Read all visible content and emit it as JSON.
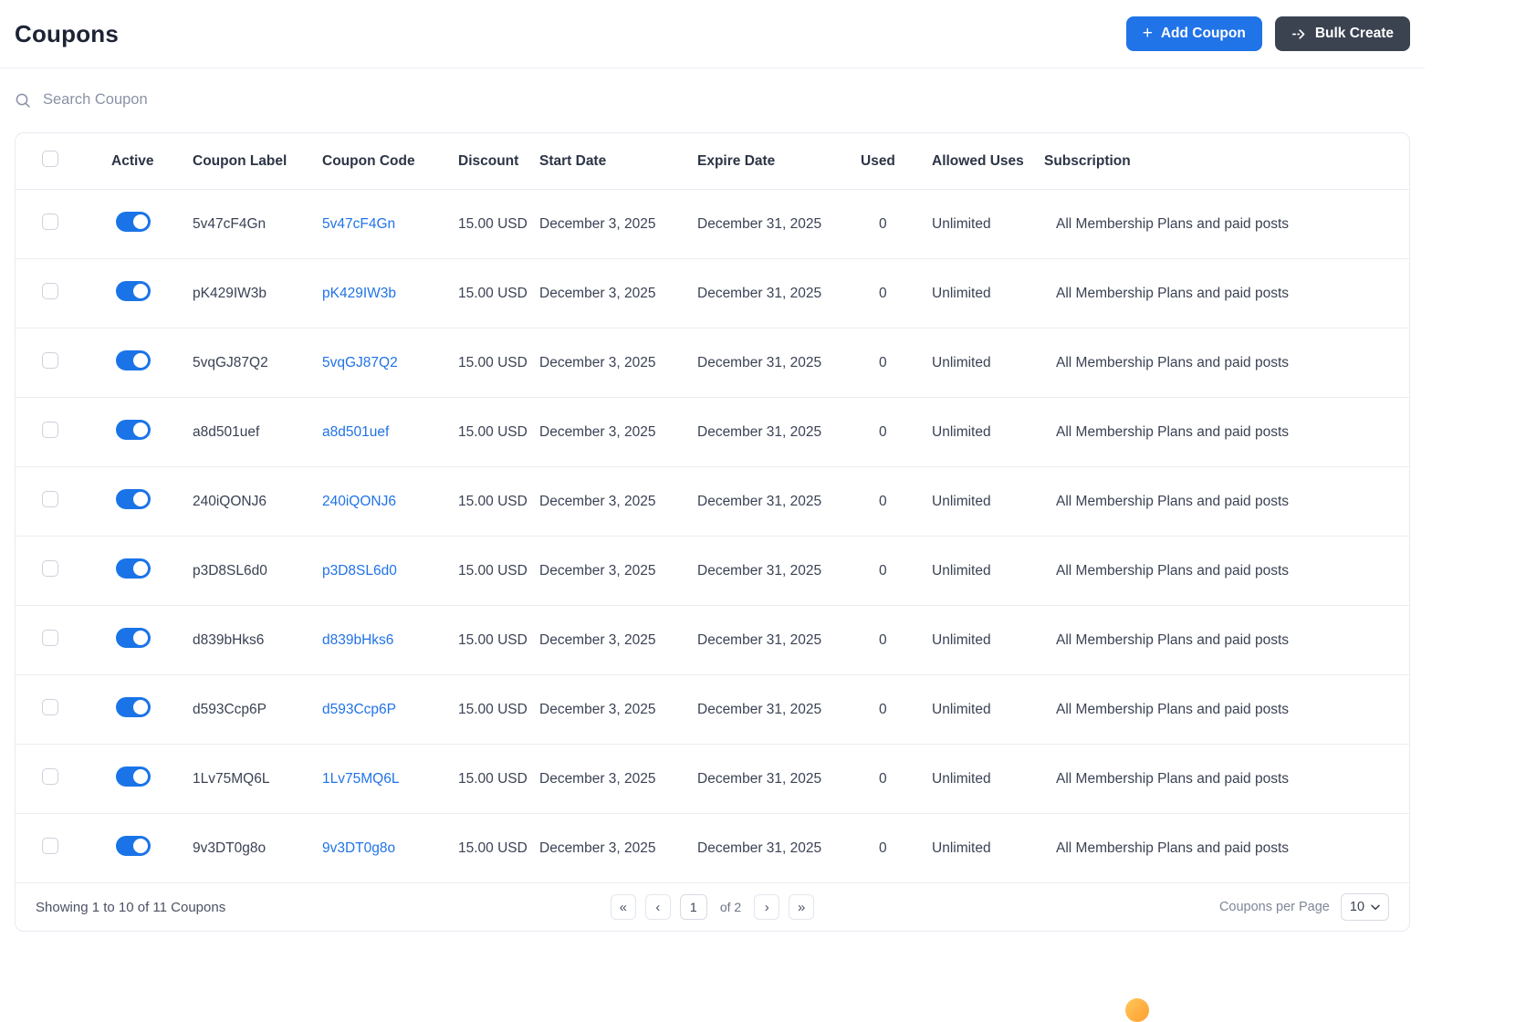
{
  "page_title": "Coupons",
  "actions": {
    "add_coupon": "Add Coupon",
    "bulk_create": "Bulk Create"
  },
  "search": {
    "placeholder": "Search Coupon"
  },
  "table": {
    "columns": [
      "Active",
      "Coupon Label",
      "Coupon Code",
      "Discount",
      "Start Date",
      "Expire Date",
      "Used",
      "Allowed Uses",
      "Subscription"
    ],
    "rows": [
      {
        "active": true,
        "label": "5v47cF4Gn",
        "code": "5v47cF4Gn",
        "discount": "15.00 USD",
        "start_date": "December 3, 2025",
        "expire_date": "December 31, 2025",
        "used": "0",
        "allowed_uses": "Unlimited",
        "subscription": "All Membership Plans and paid posts"
      },
      {
        "active": true,
        "label": "pK429IW3b",
        "code": "pK429IW3b",
        "discount": "15.00 USD",
        "start_date": "December 3, 2025",
        "expire_date": "December 31, 2025",
        "used": "0",
        "allowed_uses": "Unlimited",
        "subscription": "All Membership Plans and paid posts"
      },
      {
        "active": true,
        "label": "5vqGJ87Q2",
        "code": "5vqGJ87Q2",
        "discount": "15.00 USD",
        "start_date": "December 3, 2025",
        "expire_date": "December 31, 2025",
        "used": "0",
        "allowed_uses": "Unlimited",
        "subscription": "All Membership Plans and paid posts"
      },
      {
        "active": true,
        "label": "a8d501uef",
        "code": "a8d501uef",
        "discount": "15.00 USD",
        "start_date": "December 3, 2025",
        "expire_date": "December 31, 2025",
        "used": "0",
        "allowed_uses": "Unlimited",
        "subscription": "All Membership Plans and paid posts"
      },
      {
        "active": true,
        "label": "240iQONJ6",
        "code": "240iQONJ6",
        "discount": "15.00 USD",
        "start_date": "December 3, 2025",
        "expire_date": "December 31, 2025",
        "used": "0",
        "allowed_uses": "Unlimited",
        "subscription": "All Membership Plans and paid posts"
      },
      {
        "active": true,
        "label": "p3D8SL6d0",
        "code": "p3D8SL6d0",
        "discount": "15.00 USD",
        "start_date": "December 3, 2025",
        "expire_date": "December 31, 2025",
        "used": "0",
        "allowed_uses": "Unlimited",
        "subscription": "All Membership Plans and paid posts"
      },
      {
        "active": true,
        "label": "d839bHks6",
        "code": "d839bHks6",
        "discount": "15.00 USD",
        "start_date": "December 3, 2025",
        "expire_date": "December 31, 2025",
        "used": "0",
        "allowed_uses": "Unlimited",
        "subscription": "All Membership Plans and paid posts"
      },
      {
        "active": true,
        "label": "d593Ccp6P",
        "code": "d593Ccp6P",
        "discount": "15.00 USD",
        "start_date": "December 3, 2025",
        "expire_date": "December 31, 2025",
        "used": "0",
        "allowed_uses": "Unlimited",
        "subscription": "All Membership Plans and paid posts"
      },
      {
        "active": true,
        "label": "1Lv75MQ6L",
        "code": "1Lv75MQ6L",
        "discount": "15.00 USD",
        "start_date": "December 3, 2025",
        "expire_date": "December 31, 2025",
        "used": "0",
        "allowed_uses": "Unlimited",
        "subscription": "All Membership Plans and paid posts"
      },
      {
        "active": true,
        "label": "9v3DT0g8o",
        "code": "9v3DT0g8o",
        "discount": "15.00 USD",
        "start_date": "December 3, 2025",
        "expire_date": "December 31, 2025",
        "used": "0",
        "allowed_uses": "Unlimited",
        "subscription": "All Membership Plans and paid posts"
      }
    ]
  },
  "footer": {
    "showing": "Showing 1 to 10 of 11 Coupons",
    "pagination": {
      "first_icon": "«",
      "prev_icon": "‹",
      "page": "1",
      "of": "of 2",
      "next_icon": "›",
      "last_icon": "»"
    },
    "per_page_label": "Coupons per Page",
    "per_page": "10"
  },
  "colors": {
    "primary": "#2173e8",
    "dark-btn": "#3b4250",
    "link": "#2173e8",
    "toggle-on": "#1a74e8"
  }
}
